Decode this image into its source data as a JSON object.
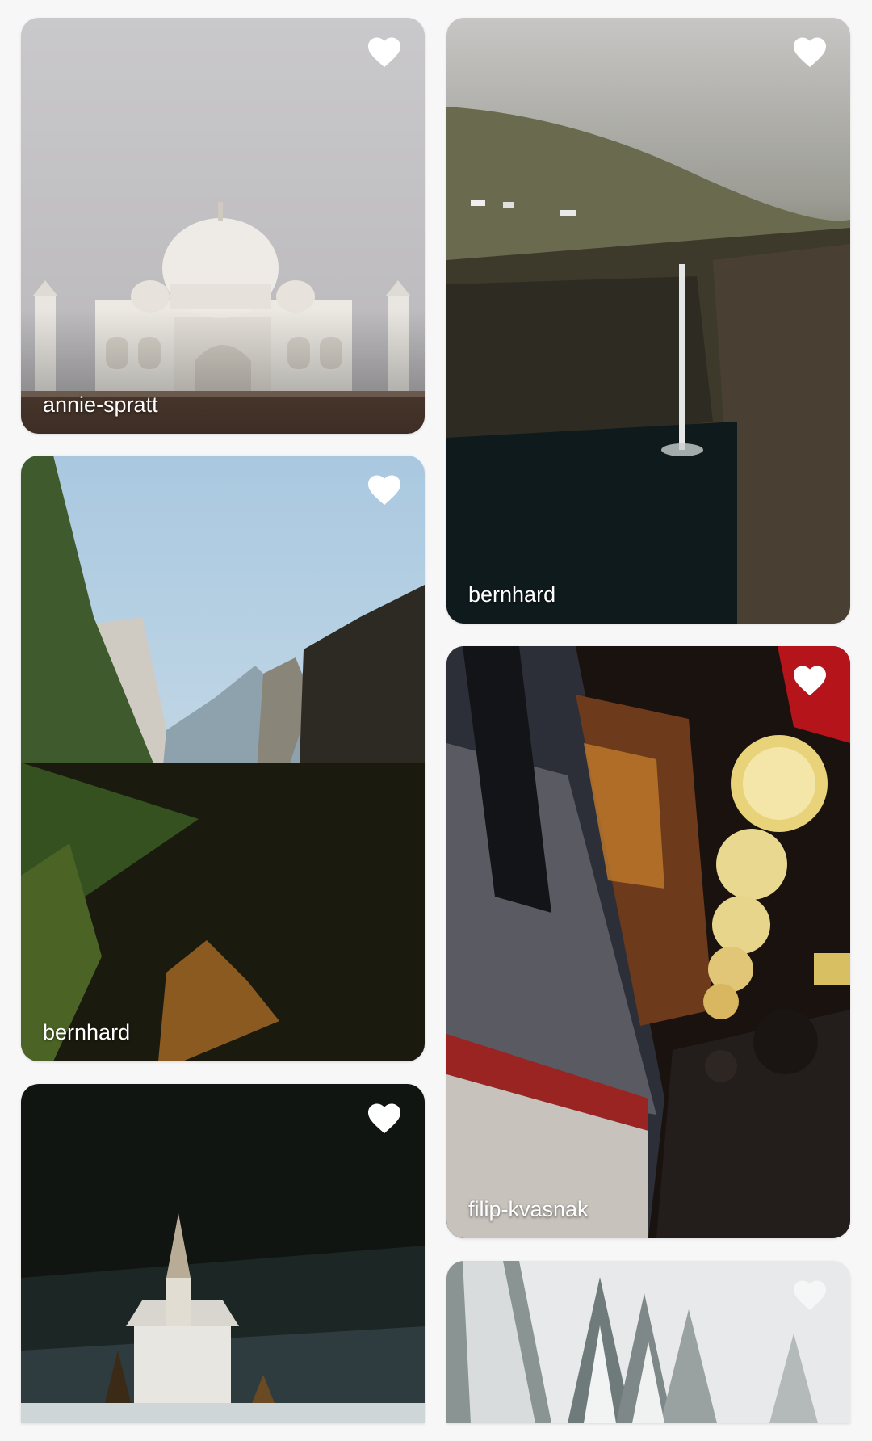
{
  "feed": {
    "cards": [
      {
        "author": "annie-spratt",
        "favorite": false,
        "scene": "taj-mahal"
      },
      {
        "author": "bernhard",
        "favorite": false,
        "scene": "waterfall-cliff"
      },
      {
        "author": "bernhard",
        "favorite": false,
        "scene": "mountain-valley"
      },
      {
        "author": "filip-kvasnak",
        "favorite": false,
        "scene": "night-train-lanterns"
      },
      {
        "author": "",
        "favorite": false,
        "scene": "church-in-forest"
      },
      {
        "author": "",
        "favorite": false,
        "scene": "snowy-trees"
      }
    ]
  },
  "colors": {
    "heart": "#ffffff",
    "background": "#f7f7f8",
    "label": "#ffffff"
  }
}
